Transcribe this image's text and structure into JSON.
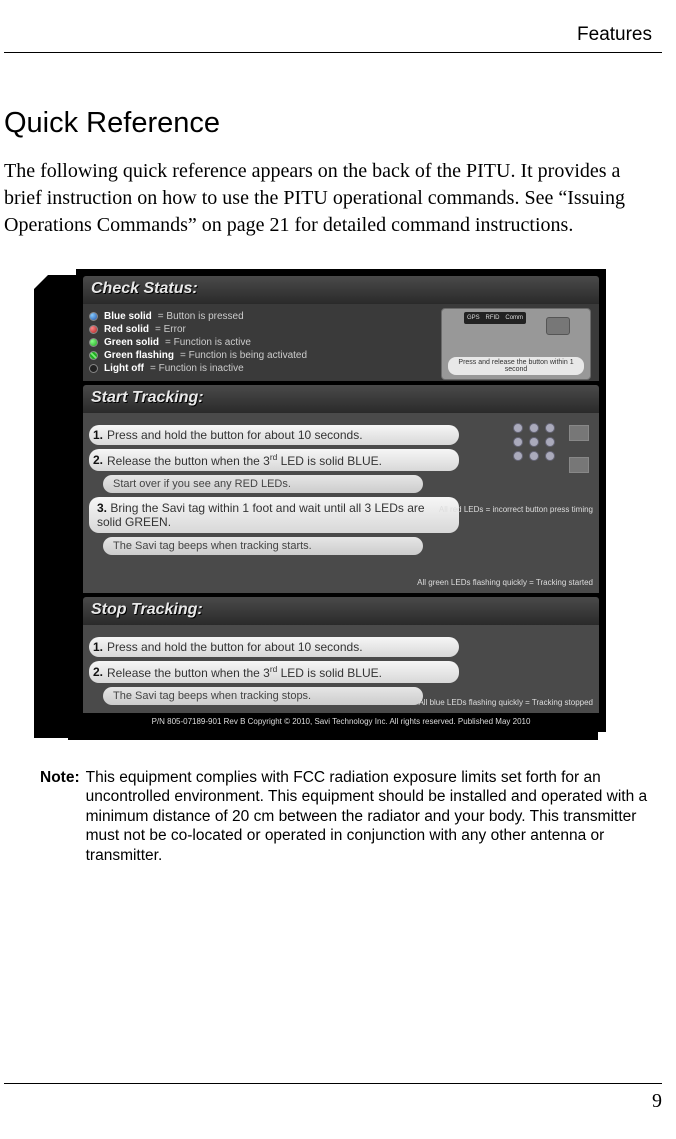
{
  "header": {
    "label": "Features"
  },
  "title": "Quick Reference",
  "intro": "The following quick reference appears on the back of the PITU. It provides a brief instruction on how to use the PITU operational commands. See “Issuing Operations Commands” on page 21 for detailed command instructions.",
  "check": {
    "title": "Check Status:",
    "rows": [
      {
        "led": "blue",
        "label": "Blue solid",
        "desc": " = Button is pressed"
      },
      {
        "led": "red",
        "label": "Red solid",
        "desc": "  = Error"
      },
      {
        "led": "green",
        "label": "Green solid",
        "desc": " = Function is active"
      },
      {
        "led": "flash",
        "label": "Green flashing",
        "desc": " = Function is being activated"
      },
      {
        "led": "off",
        "label": "Light off",
        "desc": " = Function is inactive"
      }
    ],
    "device_labels": {
      "a": "GPS",
      "b": "RFID",
      "c": "Comm"
    },
    "tip": "Press and release the button within 1 second"
  },
  "start": {
    "title": "Start Tracking:",
    "steps": [
      {
        "n": "1.",
        "t": "Press and hold the button for about 10 seconds."
      },
      {
        "n": "2.",
        "t_html": "Release the button when the 3<sup>rd</sup> LED is solid BLUE."
      }
    ],
    "sub1": "Start over if you see any RED LEDs.",
    "note1": "All red LEDs = incorrect button press timing",
    "step3": {
      "n": "3.",
      "t": "Bring the Savi tag within 1 foot and wait until all 3 LEDs are solid GREEN."
    },
    "sub2": "The Savi tag beeps when tracking starts.",
    "note2": "All green LEDs flashing quickly = Tracking started"
  },
  "stop": {
    "title": "Stop Tracking:",
    "steps": [
      {
        "n": "1.",
        "t": "Press and hold the button for about 10 seconds."
      },
      {
        "n": "2.",
        "t_html": "Release the button when the 3<sup>rd</sup> LED is solid BLUE."
      }
    ],
    "sub": "The Savi tag beeps when tracking stops.",
    "note": "All blue LEDs flashing quickly = Tracking stopped"
  },
  "card_footer": "P/N 805-07189-901 Rev B   Copyright © 2010, Savi Technology Inc.   All rights reserved.  Published May 2010",
  "note": {
    "label": "Note:",
    "text": "This equipment complies with FCC radiation exposure limits set forth for an uncontrolled environment. This equipment should be installed and operated with a minimum distance of 20 cm between the radiator and your body. This transmitter must not be co-located or operated in conjunction with any other antenna or transmitter."
  },
  "page_number": "9"
}
